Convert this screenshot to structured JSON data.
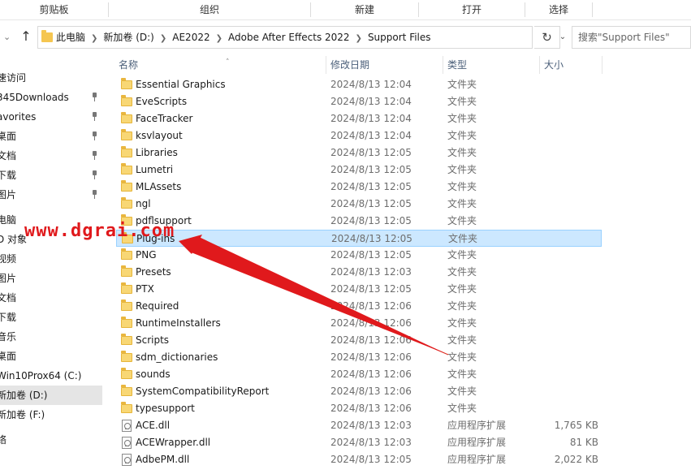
{
  "ribbon": {
    "groups": [
      "剪贴板",
      "组织",
      "新建",
      "打开",
      "选择"
    ]
  },
  "address": {
    "crumbs": [
      "此电脑",
      "新加卷 (D:)",
      "AE2022",
      "Adobe After Effects 2022",
      "Support Files"
    ]
  },
  "search": {
    "placeholder": "搜索\"Support Files\""
  },
  "nav": {
    "items": [
      {
        "label": "速访问",
        "pinned": false
      },
      {
        "label": "345Downloads",
        "pinned": true
      },
      {
        "label": "avorites",
        "pinned": true
      },
      {
        "label": "桌面",
        "pinned": true
      },
      {
        "label": "文档",
        "pinned": true
      },
      {
        "label": "下载",
        "pinned": true
      },
      {
        "label": "图片",
        "pinned": true
      },
      {
        "label": "电脑",
        "pinned": false
      },
      {
        "label": "D 对象",
        "pinned": false
      },
      {
        "label": "视频",
        "pinned": false
      },
      {
        "label": "图片",
        "pinned": false
      },
      {
        "label": "文档",
        "pinned": false
      },
      {
        "label": "下载",
        "pinned": false
      },
      {
        "label": "音乐",
        "pinned": false
      },
      {
        "label": "桌面",
        "pinned": false
      },
      {
        "label": "Win10Prox64 (C:)",
        "pinned": false
      },
      {
        "label": "新加卷 (D:)",
        "pinned": false,
        "selected": true
      },
      {
        "label": "新加卷 (F:)",
        "pinned": false
      },
      {
        "label": "络",
        "pinned": false
      }
    ]
  },
  "columns": {
    "name": "名称",
    "modified": "修改日期",
    "type": "类型",
    "size": "大小"
  },
  "files": [
    {
      "name": "Essential Graphics",
      "modified": "2024/8/13 12:04",
      "type": "文件夹",
      "size": "",
      "kind": "folder"
    },
    {
      "name": "EveScripts",
      "modified": "2024/8/13 12:04",
      "type": "文件夹",
      "size": "",
      "kind": "folder"
    },
    {
      "name": "FaceTracker",
      "modified": "2024/8/13 12:04",
      "type": "文件夹",
      "size": "",
      "kind": "folder"
    },
    {
      "name": "ksvlayout",
      "modified": "2024/8/13 12:04",
      "type": "文件夹",
      "size": "",
      "kind": "folder"
    },
    {
      "name": "Libraries",
      "modified": "2024/8/13 12:05",
      "type": "文件夹",
      "size": "",
      "kind": "folder"
    },
    {
      "name": "Lumetri",
      "modified": "2024/8/13 12:05",
      "type": "文件夹",
      "size": "",
      "kind": "folder"
    },
    {
      "name": "MLAssets",
      "modified": "2024/8/13 12:05",
      "type": "文件夹",
      "size": "",
      "kind": "folder"
    },
    {
      "name": "ngl",
      "modified": "2024/8/13 12:05",
      "type": "文件夹",
      "size": "",
      "kind": "folder"
    },
    {
      "name": "pdflsupport",
      "modified": "2024/8/13 12:05",
      "type": "文件夹",
      "size": "",
      "kind": "folder"
    },
    {
      "name": "Plug-ins",
      "modified": "2024/8/13 12:05",
      "type": "文件夹",
      "size": "",
      "kind": "folder",
      "selected": true
    },
    {
      "name": "PNG",
      "modified": "2024/8/13 12:05",
      "type": "文件夹",
      "size": "",
      "kind": "folder"
    },
    {
      "name": "Presets",
      "modified": "2024/8/13 12:03",
      "type": "文件夹",
      "size": "",
      "kind": "folder"
    },
    {
      "name": "PTX",
      "modified": "2024/8/13 12:05",
      "type": "文件夹",
      "size": "",
      "kind": "folder"
    },
    {
      "name": "Required",
      "modified": "2024/8/13 12:06",
      "type": "文件夹",
      "size": "",
      "kind": "folder"
    },
    {
      "name": "RuntimeInstallers",
      "modified": "2024/8/13 12:06",
      "type": "文件夹",
      "size": "",
      "kind": "folder"
    },
    {
      "name": "Scripts",
      "modified": "2024/8/13 12:06",
      "type": "文件夹",
      "size": "",
      "kind": "folder"
    },
    {
      "name": "sdm_dictionaries",
      "modified": "2024/8/13 12:06",
      "type": "文件夹",
      "size": "",
      "kind": "folder"
    },
    {
      "name": "sounds",
      "modified": "2024/8/13 12:06",
      "type": "文件夹",
      "size": "",
      "kind": "folder"
    },
    {
      "name": "SystemCompatibilityReport",
      "modified": "2024/8/13 12:06",
      "type": "文件夹",
      "size": "",
      "kind": "folder"
    },
    {
      "name": "typesupport",
      "modified": "2024/8/13 12:06",
      "type": "文件夹",
      "size": "",
      "kind": "folder"
    },
    {
      "name": "ACE.dll",
      "modified": "2024/8/13 12:03",
      "type": "应用程序扩展",
      "size": "1,765 KB",
      "kind": "dll"
    },
    {
      "name": "ACEWrapper.dll",
      "modified": "2024/8/13 12:03",
      "type": "应用程序扩展",
      "size": "81 KB",
      "kind": "dll"
    },
    {
      "name": "AdbePM.dll",
      "modified": "2024/8/13 12:05",
      "type": "应用程序扩展",
      "size": "2,022 KB",
      "kind": "dll"
    }
  ],
  "watermark": "www.dgrai.com",
  "colors": {
    "selection_bg": "#cce8ff",
    "selection_border": "#99d1ff",
    "annotation_red": "#e0191c",
    "folder_yellow": "#f8d775"
  }
}
